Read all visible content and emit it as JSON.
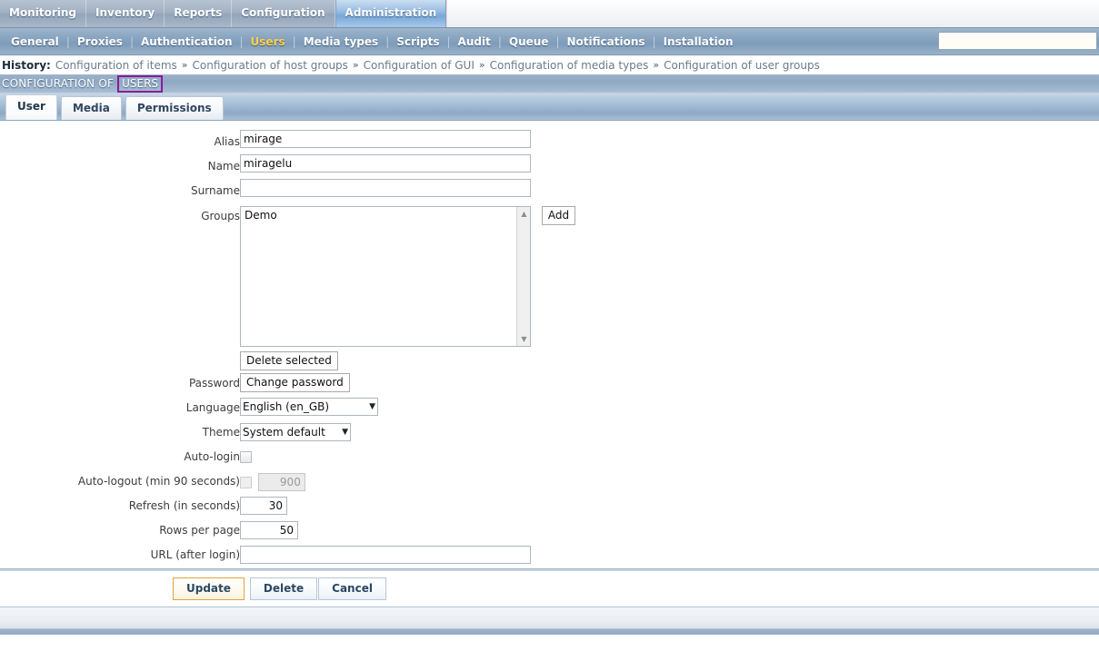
{
  "topmenu": {
    "items": [
      {
        "label": "Monitoring",
        "selected": false
      },
      {
        "label": "Inventory",
        "selected": false
      },
      {
        "label": "Reports",
        "selected": false
      },
      {
        "label": "Configuration",
        "selected": false
      },
      {
        "label": "Administration",
        "selected": true
      }
    ]
  },
  "submenu": {
    "items": [
      {
        "label": "General",
        "active": false
      },
      {
        "label": "Proxies",
        "active": false
      },
      {
        "label": "Authentication",
        "active": false
      },
      {
        "label": "Users",
        "active": true
      },
      {
        "label": "Media types",
        "active": false
      },
      {
        "label": "Scripts",
        "active": false
      },
      {
        "label": "Audit",
        "active": false
      },
      {
        "label": "Queue",
        "active": false
      },
      {
        "label": "Notifications",
        "active": false
      },
      {
        "label": "Installation",
        "active": false
      }
    ],
    "separator": "|",
    "search_value": "",
    "search_placeholder": ""
  },
  "history": {
    "label": "History:",
    "arrow": "»",
    "items": [
      "Configuration of items",
      "Configuration of host groups",
      "Configuration of GUI",
      "Configuration of media types",
      "Configuration of user groups"
    ]
  },
  "titlebar": {
    "prefix": "CONFIGURATION OF",
    "editable": "USERS",
    "highlight_color": "#8b1a9b"
  },
  "tabs": [
    {
      "label": "User",
      "active": true
    },
    {
      "label": "Media",
      "active": false
    },
    {
      "label": "Permissions",
      "active": false
    }
  ],
  "form": {
    "alias": {
      "label": "Alias",
      "value": "mirage"
    },
    "name": {
      "label": "Name",
      "value": "miragelu"
    },
    "surname": {
      "label": "Surname",
      "value": ""
    },
    "groups": {
      "label": "Groups",
      "options": [
        "Demo"
      ],
      "add_button": "Add",
      "delete_button": "Delete selected"
    },
    "password": {
      "label": "Password",
      "button": "Change password"
    },
    "language": {
      "label": "Language",
      "value": "English (en_GB)",
      "caret": "▼"
    },
    "theme": {
      "label": "Theme",
      "value": "System default",
      "caret": "▼"
    },
    "autologin": {
      "label": "Auto-login",
      "checked": false
    },
    "autologout": {
      "label": "Auto-logout (min 90 seconds)",
      "checked": false,
      "value": "900",
      "disabled": true
    },
    "refresh": {
      "label": "Refresh (in seconds)",
      "value": "30"
    },
    "rows_per_page": {
      "label": "Rows per page",
      "value": "50"
    },
    "url_after_login": {
      "label": "URL (after login)",
      "value": ""
    }
  },
  "actions": {
    "update": "Update",
    "delete": "Delete",
    "cancel": "Cancel",
    "primary_color": "#e2a23c"
  }
}
